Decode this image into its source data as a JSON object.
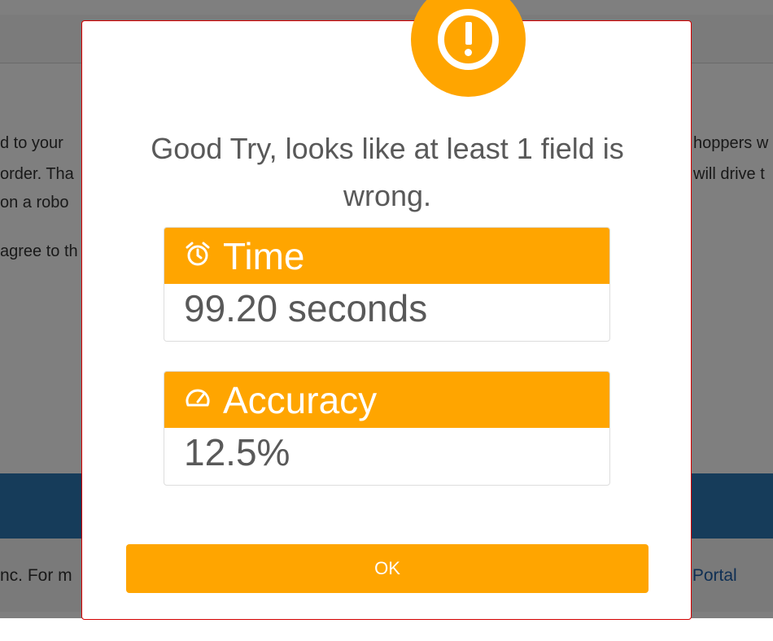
{
  "background": {
    "lines": [
      "d to your",
      "order. Tha",
      " on a robo",
      "agree to th"
    ],
    "right_lines": [
      "hoppers w",
      "will drive t"
    ],
    "footer_left": "nc. For m",
    "footer_link": "r Portal"
  },
  "modal": {
    "title": "Good Try, looks like at least 1 field is wrong.",
    "alert_icon": "exclamation-circle-icon",
    "cards": [
      {
        "icon": "alarm-clock-icon",
        "label": "Time",
        "value": "99.20 seconds"
      },
      {
        "icon": "speedometer-icon",
        "label": "Accuracy",
        "value": "12.5%"
      }
    ],
    "ok_label": "OK"
  },
  "colors": {
    "accent": "#ffa500",
    "overlay": "rgba(0,0,0,0.5)",
    "modal_border": "#d40000"
  }
}
